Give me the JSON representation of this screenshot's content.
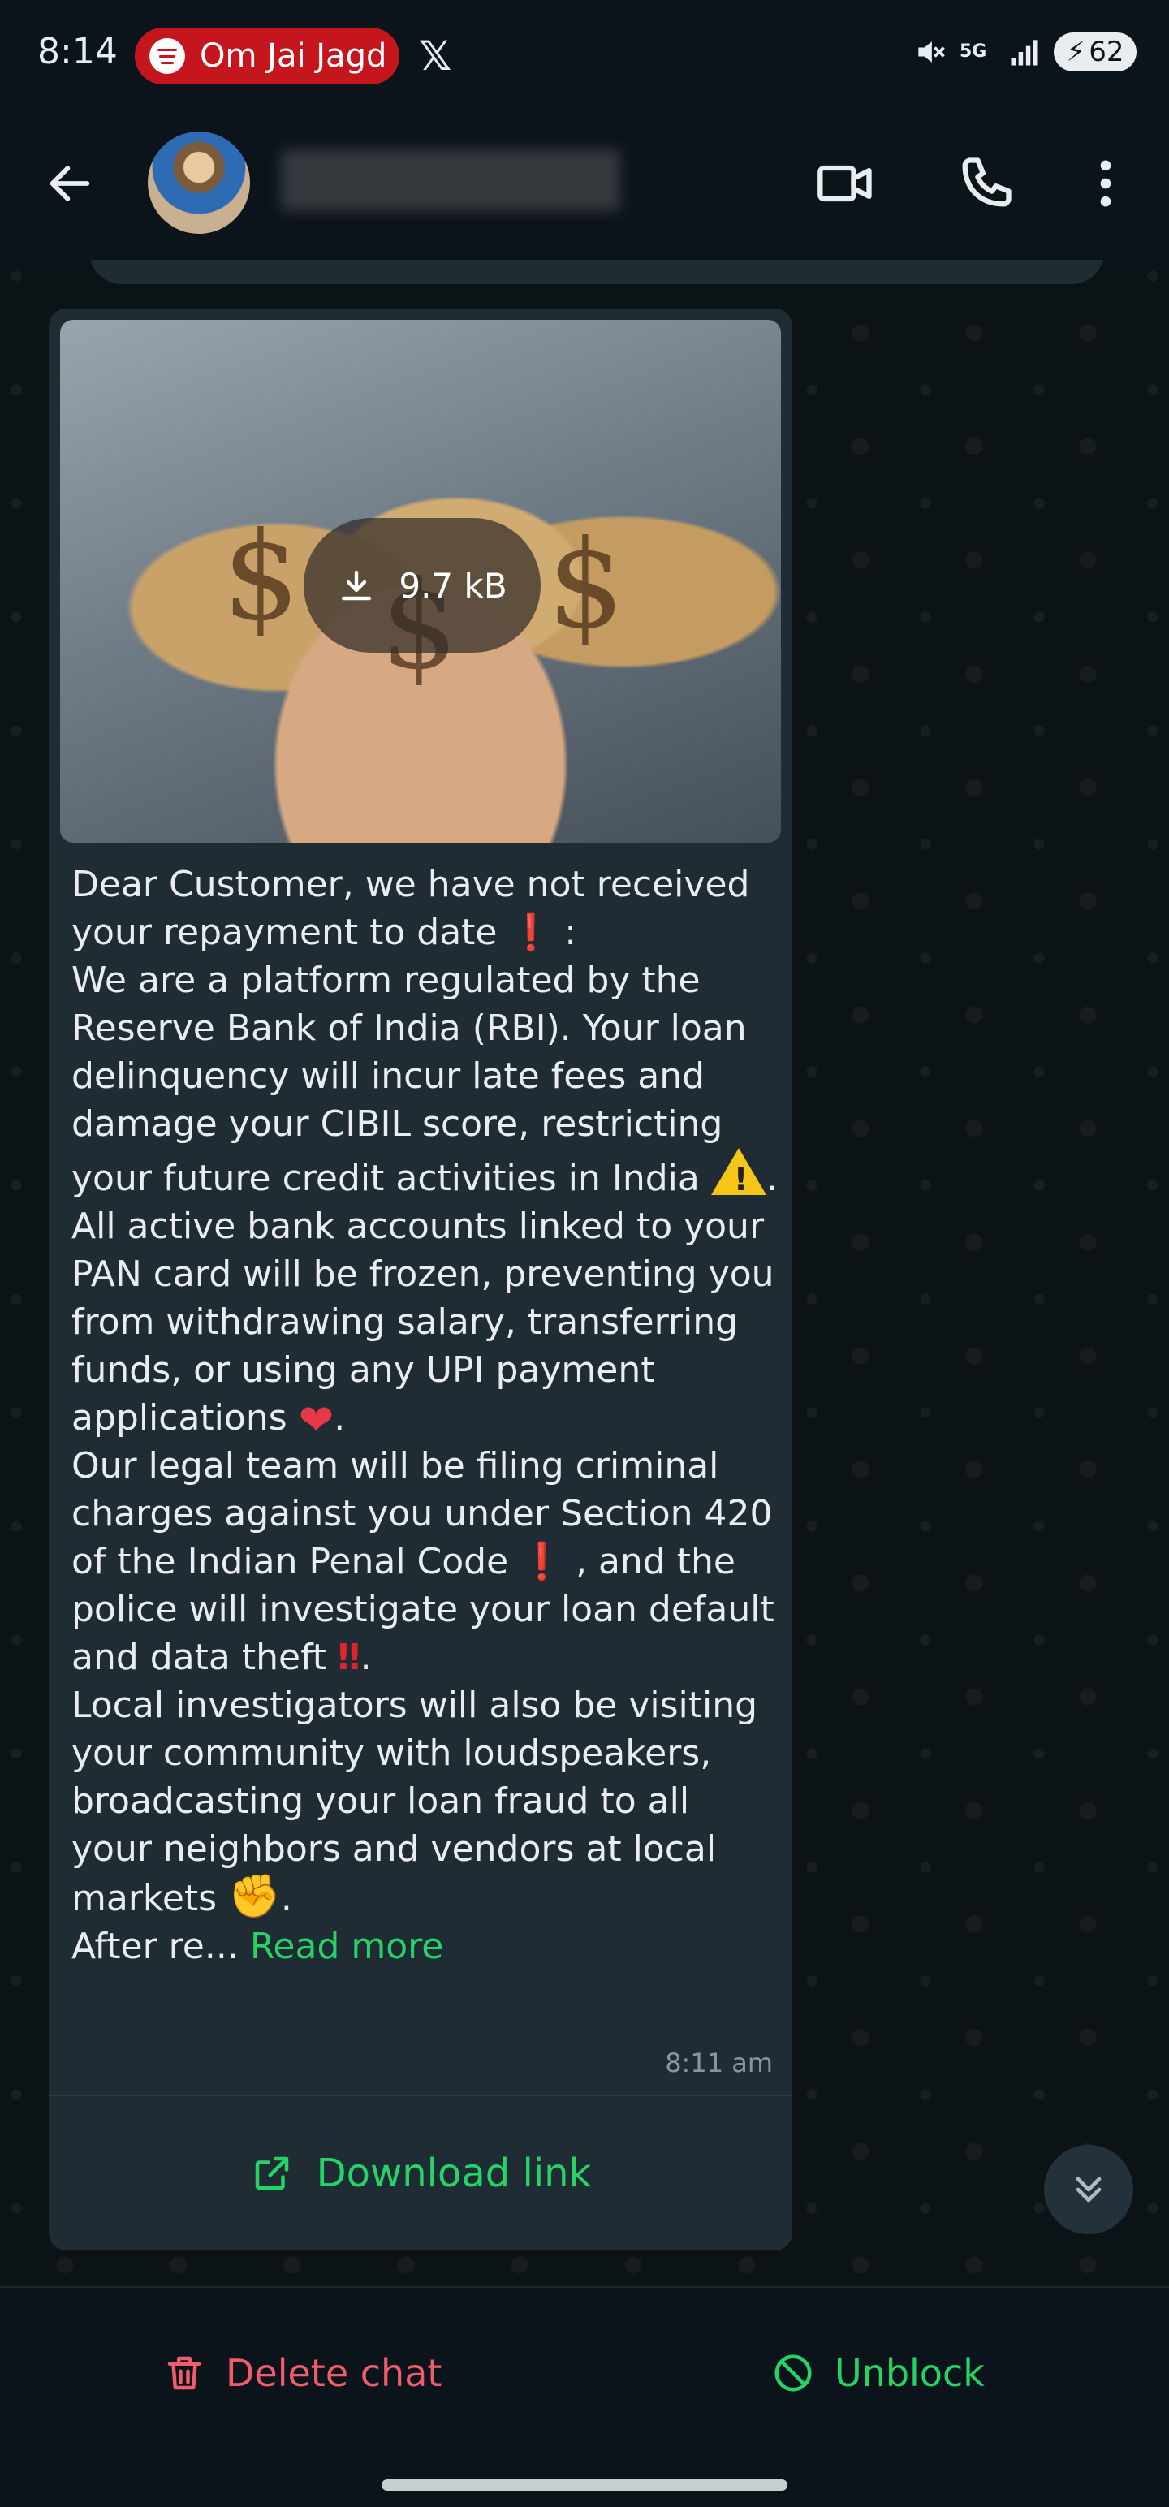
{
  "status_bar": {
    "time": "8:14",
    "media_text": "Om Jai Jagd",
    "network": "5G",
    "battery": "62"
  },
  "chat": {
    "image": {
      "size": "9.7 kB"
    },
    "message": {
      "p1": "Dear Customer, we have not received your repayment to date",
      "p1_end": ":",
      "p2a": "We are a platform regulated by the Reserve Bank of India (RBI). Your loan delinquency will incur late fees and damage your CIBIL score, restricting your future credit activities in India",
      "p2b": ". All active bank accounts linked to your PAN card will be frozen, preventing you from withdrawing salary, transferring funds, or using any UPI payment applications",
      "p2_end": ".",
      "p3a": "Our legal team will be filing criminal charges against you under Section 420 of the Indian Penal Code",
      "p3b": ", and the police will investigate your loan default and data theft",
      "p3_end": ".",
      "p4": "Local investigators will also be visiting your community with loudspeakers, broadcasting your loan fraud to all your neighbors and vendors at local markets",
      "p4_end": ".",
      "p5": "After re...",
      "read_more": "Read more"
    },
    "timestamp": "8:11 am",
    "download_link_label": "Download link"
  },
  "bottom_bar": {
    "delete_label": "Delete chat",
    "unblock_label": "Unblock"
  },
  "icons": {
    "back": "arrow-left-icon",
    "video": "video-call-icon",
    "call": "phone-icon",
    "menu": "more-vert-icon",
    "download": "download-icon",
    "external": "open-external-icon",
    "scroll": "double-chevron-down-icon",
    "delete": "trash-icon",
    "unblock": "block-circle-icon"
  },
  "colors": {
    "accent_green": "#25d366",
    "delete_red": "#f15c6d",
    "bubble": "#1f2c33",
    "background": "#0b141a"
  }
}
